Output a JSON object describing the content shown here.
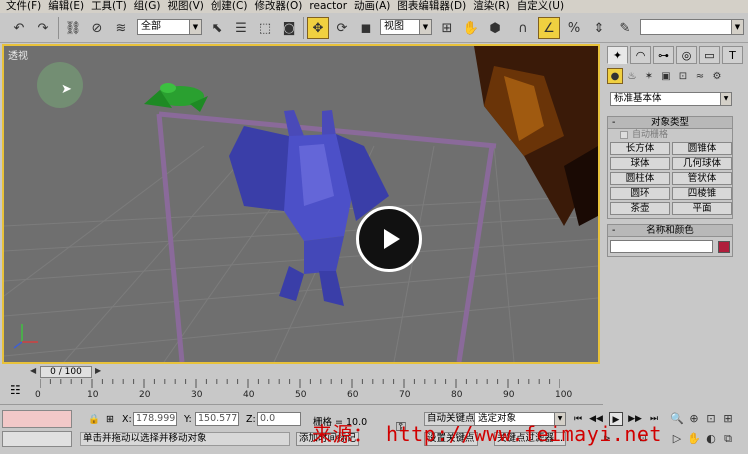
{
  "menu": {
    "items": [
      "文件(F)",
      "编辑(E)",
      "工具(T)",
      "组(G)",
      "视图(V)",
      "创建(C)",
      "修改器(O)",
      "reactor",
      "动画(A)",
      "图表编辑器(D)",
      "渲染(R)",
      "自定义(U)"
    ]
  },
  "toolbar": {
    "filter_value": "全部",
    "refcoord_value": "视图"
  },
  "viewport": {
    "label": "透视",
    "accent_color": "#e8c23a"
  },
  "command_panel": {
    "category_dropdown": "标准基本体",
    "object_type": {
      "header": "对象类型",
      "autogrid_label": "自动栅格",
      "buttons": [
        "长方体",
        "圆锥体",
        "球体",
        "几何球体",
        "圆柱体",
        "管状体",
        "圆环",
        "四棱锥",
        "茶壶",
        "平面"
      ]
    },
    "name_color": {
      "header": "名称和颜色",
      "name_value": "",
      "swatch_color": "#b01e3c"
    }
  },
  "timeline": {
    "slider_text": "0 / 100",
    "current_frame": 0,
    "total_frames": 100,
    "ticks": [
      "0",
      "10",
      "20",
      "30",
      "40",
      "50",
      "60",
      "70",
      "80",
      "90",
      "100"
    ]
  },
  "status": {
    "x_label": "X:",
    "x_value": "178.999",
    "y_label": "Y:",
    "y_value": "150.577",
    "z_label": "Z:",
    "z_value": "0.0",
    "grid_text": "栅格 = 10.0",
    "prompt_text": "单击并拖动以选择并移动对象",
    "autokey_label": "自动关键点",
    "selection_value": "选定对象",
    "setkey_label": "设置关键点",
    "keyfilter_label": "关键点过滤器...",
    "add_time_tag": "添加时间标记"
  },
  "watermark": {
    "text": "来源： http://www.feimayi.net"
  }
}
